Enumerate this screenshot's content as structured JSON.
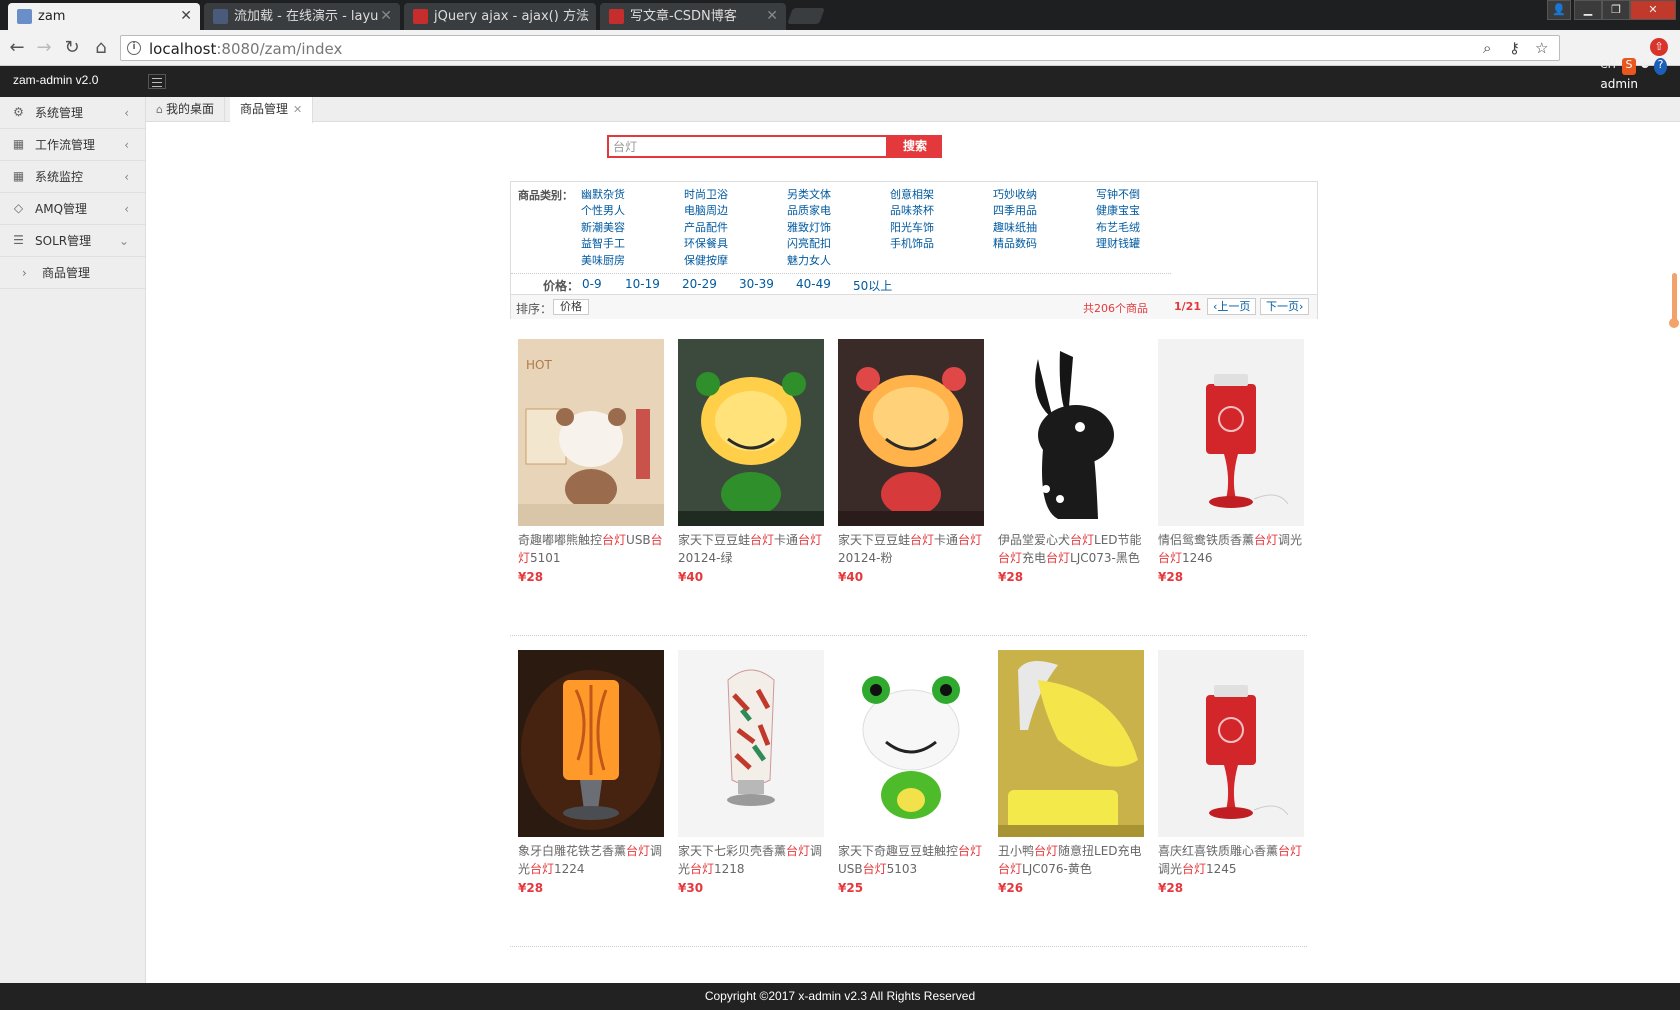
{
  "browser": {
    "tabs": [
      {
        "label": "zam",
        "active": true,
        "favicon_color": "#6a8fc8"
      },
      {
        "label": "流加载 - 在线演示 - layu",
        "active": false,
        "favicon_color": "#2b2b2b"
      },
      {
        "label": "jQuery ajax - ajax() 方法",
        "active": false,
        "favicon_color": "#c62e2e"
      },
      {
        "label": "写文章-CSDN博客",
        "active": false,
        "favicon_color": "#c62e2e"
      }
    ],
    "url_host": "localhost",
    "url_rest": ":8080/zam/index",
    "ime": "CH"
  },
  "app": {
    "logo": "zam-admin v2.0",
    "user": "admin"
  },
  "sidebar": {
    "items": [
      {
        "label": "系统管理",
        "icon": "gear-icon"
      },
      {
        "label": "工作流管理",
        "icon": "grid-icon"
      },
      {
        "label": "系统监控",
        "icon": "grid-icon"
      },
      {
        "label": "AMQ管理",
        "icon": "tag-icon"
      },
      {
        "label": "SOLR管理",
        "icon": "list-icon"
      }
    ],
    "sub_items": [
      {
        "label": "商品管理"
      }
    ]
  },
  "content_tabs": [
    {
      "label": "我的桌面",
      "icon": "home-icon"
    },
    {
      "label": "商品管理",
      "active": true
    }
  ],
  "search": {
    "value": "台灯",
    "button": "搜索"
  },
  "filter": {
    "category_label": "商品类别：",
    "categories": [
      [
        "幽默杂货",
        "个性男人",
        "新潮美容",
        "益智手工",
        "美味厨房"
      ],
      [
        "时尚卫浴",
        "电脑周边",
        "产品配件",
        "环保餐具",
        "保健按摩"
      ],
      [
        "另类文体",
        "品质家电",
        "雅致灯饰",
        "闪亮配扣",
        "魅力女人"
      ],
      [
        "创意相架",
        "品味茶杯",
        "阳光车饰",
        "手机饰品"
      ],
      [
        "巧妙收纳",
        "四季用品",
        "趣味纸抽",
        "精品数码"
      ],
      [
        "写钟不倒",
        "健康宝宝",
        "布艺毛绒",
        "理财钱罐"
      ]
    ],
    "price_label": "价格：",
    "prices": [
      "0-9",
      "10-19",
      "20-29",
      "30-39",
      "40-49",
      "50以上"
    ],
    "sort_label": "排序：",
    "sort_button": "价格",
    "total": "共206个商品",
    "page": "1/21",
    "prev": "上一页",
    "next": "下一页"
  },
  "products": [
    {
      "name_parts": [
        "奇趣嘟嘟熊触控",
        "台灯",
        "USB",
        "台灯",
        "5101"
      ],
      "price": "¥28",
      "image": "bear-lamp-photo"
    },
    {
      "name_parts": [
        "家天下豆豆蛙",
        "台灯",
        "卡通",
        "台灯",
        "20124-绿"
      ],
      "price": "¥40",
      "image": "green-frog-lamp-photo"
    },
    {
      "name_parts": [
        "家天下豆豆蛙",
        "台灯",
        "卡通",
        "台灯",
        "20124-粉"
      ],
      "price": "¥40",
      "image": "pink-frog-lamp-photo"
    },
    {
      "name_parts": [
        "伊品堂爱心犬",
        "台灯",
        "LED节能",
        "台灯",
        "充电",
        "台灯",
        "LJC073-黑色"
      ],
      "price": "¥28",
      "image": "black-dog-lamp-photo"
    },
    {
      "name_parts": [
        "情侣鸳鸯铁质香薰",
        "台灯",
        "调光",
        "台灯",
        "1246"
      ],
      "price": "¥28",
      "image": "red-aroma-lamp-photo"
    },
    {
      "name_parts": [
        "象牙白雕花铁艺香薰",
        "台灯",
        "调光",
        "台灯",
        "1224"
      ],
      "price": "¥28",
      "image": "orange-carved-lamp-photo"
    },
    {
      "name_parts": [
        "家天下七彩贝壳香薰",
        "台灯",
        "调光",
        "台灯",
        "1218"
      ],
      "price": "¥30",
      "image": "shell-lamp-photo"
    },
    {
      "name_parts": [
        "家天下奇趣豆豆蛙触控",
        "台灯",
        "USB",
        "台灯",
        "5103"
      ],
      "price": "¥25",
      "image": "frog-touch-lamp-photo"
    },
    {
      "name_parts": [
        "丑小鸭",
        "台灯",
        "随意扭LED充电",
        "台灯",
        "LJC076-黄色"
      ],
      "price": "¥26",
      "image": "yellow-duck-lamp-photo"
    },
    {
      "name_parts": [
        "喜庆红喜铁质雕心香薰",
        "台灯",
        "调光",
        "台灯",
        "1245"
      ],
      "price": "¥28",
      "image": "red-heart-lamp-photo"
    }
  ],
  "footer": "Copyright ©2017 x-admin v2.3 All Rights Reserved"
}
